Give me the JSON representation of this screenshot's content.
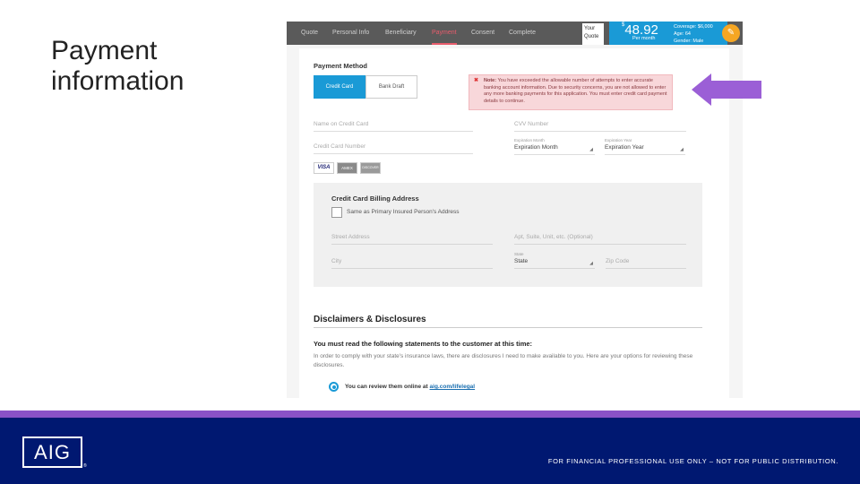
{
  "slide": {
    "title": "Payment information"
  },
  "nav": {
    "tabs": [
      "Quote",
      "Personal Info",
      "Beneficiary",
      "Payment",
      "Consent",
      "Complete"
    ],
    "active_tab": "Payment"
  },
  "quote": {
    "label": "Your Quote",
    "currency": "$",
    "price": "48.92",
    "per": "Per month",
    "coverage": "Coverage: $6,000",
    "age": "Age: 64",
    "gender": "Gender: Male",
    "edit_icon": "pencil-icon"
  },
  "payment": {
    "heading": "Payment Method",
    "credit_card": "Credit Card",
    "bank_draft": "Bank Draft",
    "error_icon": "x-icon",
    "error_prefix": "Note:",
    "error_text": "You have exceeded the allowable number of attempts to enter accurate banking account information. Due to security concerns, you are not allowed to enter any more banking payments for this application. You must enter credit card payment details to continue.",
    "name_placeholder": "Name on Credit Card",
    "cvv_placeholder": "CVV Number",
    "card_number_placeholder": "Credit Card Number",
    "exp_month_label": "Expiration Month",
    "exp_month_value": "Expiration Month",
    "exp_year_label": "Expiration Year",
    "exp_year_value": "Expiration Year",
    "card_logos": [
      "VISA",
      "AMEX",
      "DISCOVER"
    ]
  },
  "billing": {
    "heading": "Credit Card Billing Address",
    "same_as": "Same as Primary Insured Person's Address",
    "street": "Street Address",
    "apt": "Apt, Suite, Unit, etc. (Optional)",
    "city": "City",
    "state_label": "State",
    "state_value": "State",
    "zip": "Zip Code"
  },
  "disclosures": {
    "title": "Disclaimers & Disclosures",
    "must_read": "You must read the following statements to the customer at this time:",
    "body": "In order to comply with your state's insurance laws, there are disclosures I need to make available to you. Here are your options for reviewing these disclosures.",
    "option_text": "You can review them online at",
    "option_link": "aig.com/lifelegal"
  },
  "footer": {
    "logo": "AIG",
    "registered": "®",
    "disclaimer": "FOR FINANCIAL PROFESSIONAL USE ONLY – NOT FOR PUBLIC DISTRIBUTION."
  },
  "colors": {
    "accent_blue": "#1a9ad6",
    "arrow_purple": "#9b5fd6",
    "footer_navy": "#001871",
    "purple_bar": "#8a52c7",
    "active_tab": "#e85c6c"
  }
}
